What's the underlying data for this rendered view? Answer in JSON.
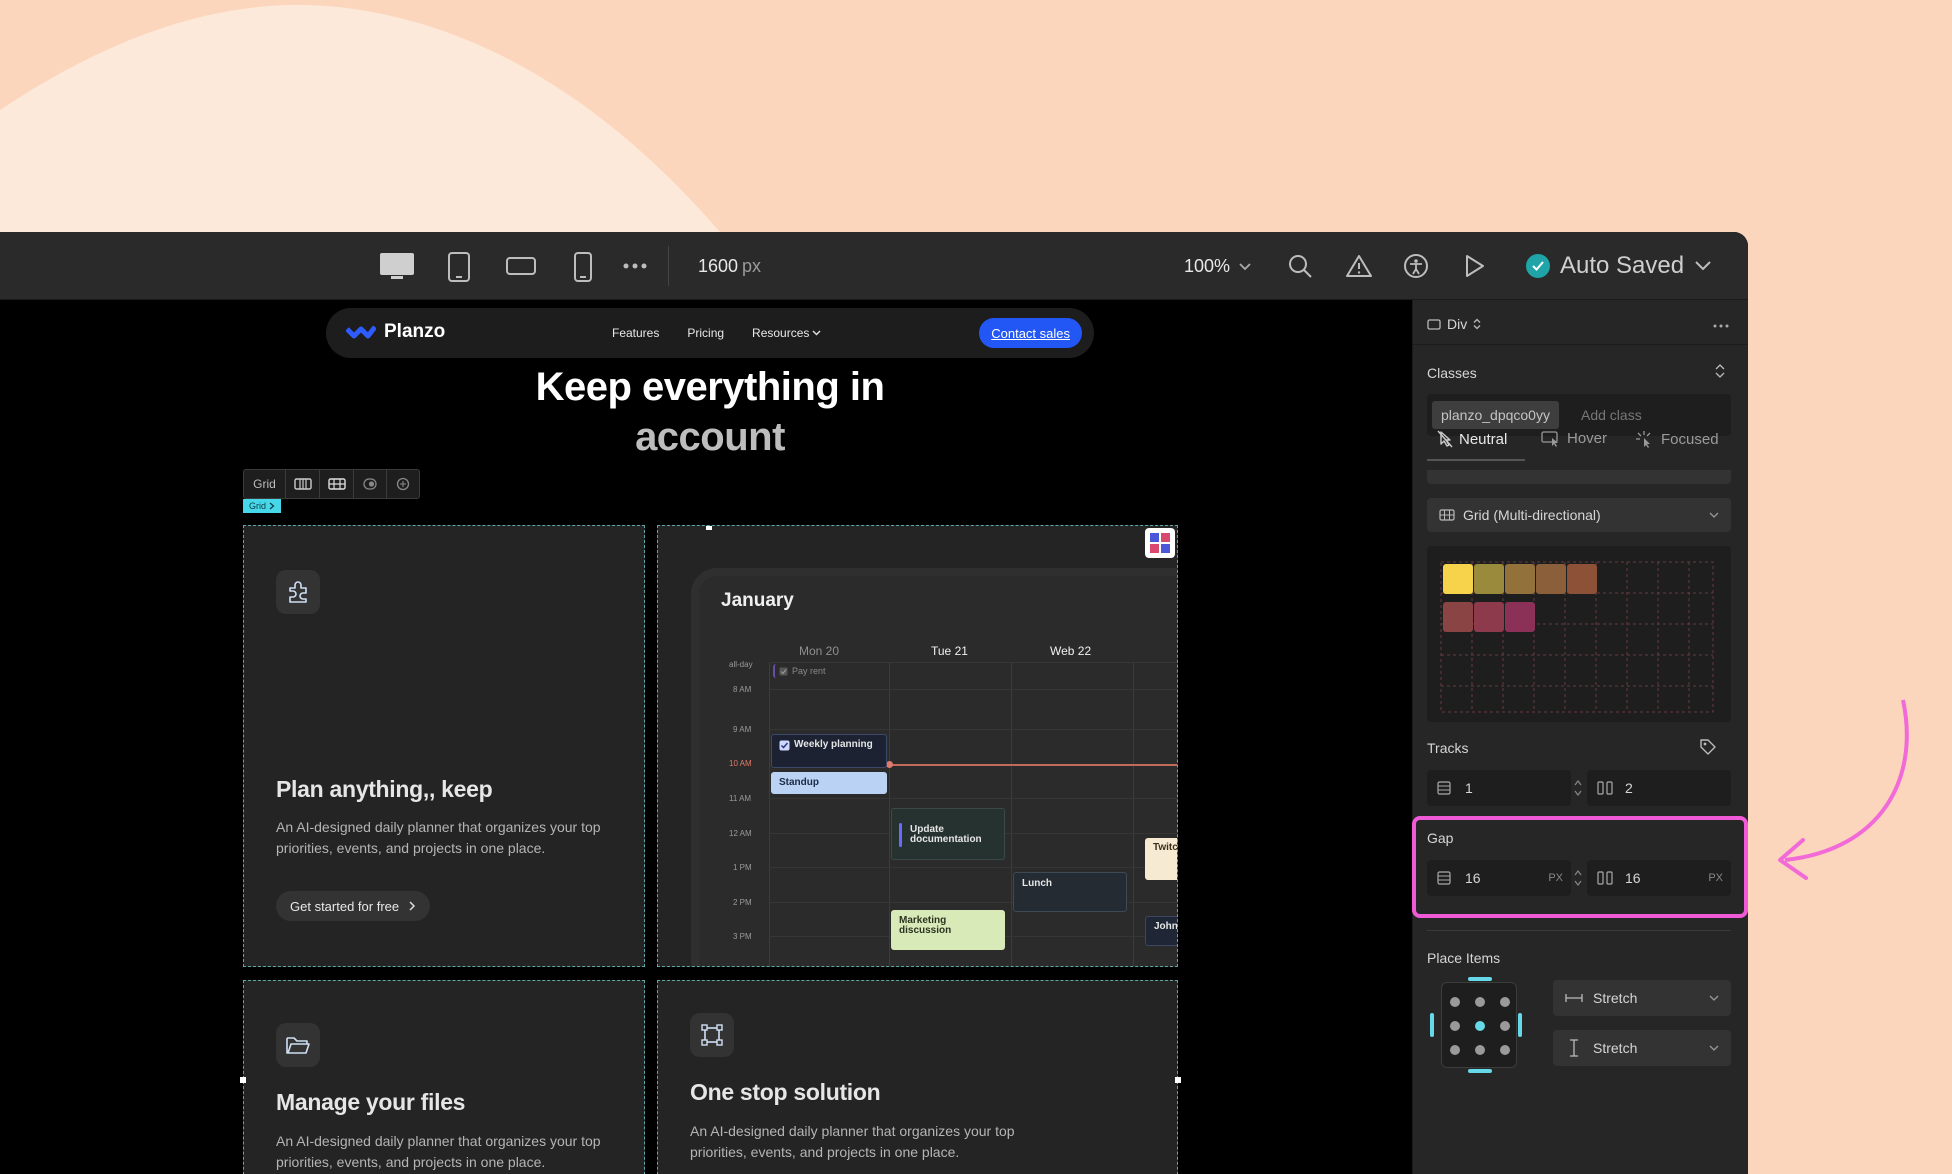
{
  "toolbar": {
    "width_value": "1600",
    "width_unit": "px",
    "zoom": "100%",
    "save_status": "Auto Saved"
  },
  "site": {
    "brand": "Planzo",
    "nav": [
      "Features",
      "Pricing",
      "Resources"
    ],
    "cta": "Contact sales",
    "hero_line1": "Keep everything in",
    "hero_line2": "account"
  },
  "grid_toolbar": {
    "label": "Grid",
    "tag": "Grid"
  },
  "cards": [
    {
      "title": "Plan anything,, keep",
      "desc": "An AI-designed daily planner that organizes your top priorities, events, and projects in one place.",
      "button": "Get started for free"
    },
    {
      "title": "Manage your files",
      "desc": "An AI-designed daily planner that organizes your top priorities, events, and projects in one place."
    },
    {
      "title": "One stop solution",
      "desc": "An AI-designed daily planner that organizes your top priorities, events, and projects in one place."
    }
  ],
  "calendar": {
    "month": "January",
    "days": [
      "Mon 20",
      "Tue 21",
      "Web 22"
    ],
    "times": [
      "all-day",
      "8 AM",
      "9 AM",
      "10 AM",
      "11 AM",
      "12 AM",
      "1 PM",
      "2 PM",
      "3 PM"
    ],
    "events": {
      "pay_rent": "Pay rent",
      "weekly": "Weekly planning",
      "standup": "Standup",
      "update_doc": "Update documentation",
      "lunch": "Lunch",
      "marketing": "Marketing discussion",
      "twitch": "Twitch",
      "john": "John:S"
    }
  },
  "panel": {
    "element": "Div",
    "classes_label": "Classes",
    "class_pill": "planzo_dpqco0yy",
    "add_class_placeholder": "Add class",
    "states": [
      "Neutral",
      "Hover",
      "Focused"
    ],
    "layout": "Grid (Multi-directional)",
    "tracks_label": "Tracks",
    "tracks_rows": "1",
    "tracks_cols": "2",
    "gap_label": "Gap",
    "gap_row": "16",
    "gap_col": "16",
    "gap_unit": "PX",
    "place_items_label": "Place Items",
    "place_h": "Stretch",
    "place_v": "Stretch",
    "grid_cell_colors": [
      "#f6d34a",
      "#9a8a3c",
      "#93713a",
      "#8c5f3b",
      "#8d5138",
      "#8b4444",
      "#8e3a4d",
      "#8b3158"
    ]
  }
}
